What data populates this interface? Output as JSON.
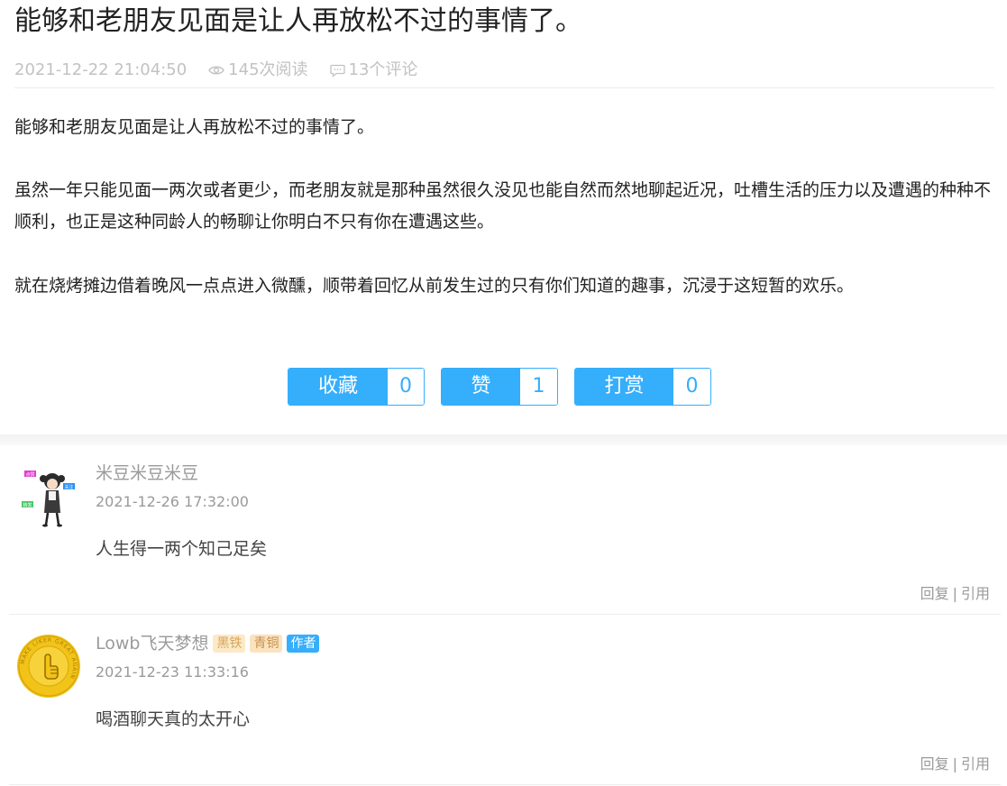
{
  "article": {
    "title": "能够和老朋友见面是让人再放松不过的事情了。",
    "date": "2021-12-22 21:04:50",
    "views": "145次阅读",
    "comments": "13个评论",
    "paragraphs": [
      "能够和老朋友见面是让人再放松不过的事情了。",
      "虽然一年只能见面一两次或者更少，而老朋友就是那种虽然很久没见也能自然而然地聊起近况，吐槽生活的压力以及遭遇的种种不顺利，也正是这种同龄人的畅聊让你明白不只有你在遭遇这些。",
      "就在烧烤摊边借着晚风一点点进入微醺，顺带着回忆从前发生过的只有你们知道的趣事，沉浸于这短暂的欢乐。"
    ]
  },
  "actions": [
    {
      "label": "收藏",
      "count": "0"
    },
    {
      "label": "赞",
      "count": "1"
    },
    {
      "label": "打赏",
      "count": "0"
    }
  ],
  "comments": [
    {
      "name": "米豆米豆米豆",
      "time": "2021-12-26 17:32:00",
      "text": "人生得一两个知己足矣",
      "badges": [],
      "avatar_tags": [
        "点赞",
        "关注",
        "转发"
      ],
      "reply": "回复",
      "quote": "引用",
      "sep": "|"
    },
    {
      "name": "Lowb飞天梦想",
      "time": "2021-12-23 11:33:16",
      "text": "喝酒聊天真的太开心",
      "badges": [
        "黑铁",
        "青铜",
        "作者"
      ],
      "avatar_ring_text": "MAKE LIKER GREAT AGAIN",
      "reply": "回复",
      "quote": "引用",
      "sep": "|"
    }
  ],
  "colors": {
    "accent": "#35aefb",
    "meta": "#c2c2c2",
    "gold": "#f2c318"
  },
  "icons": {
    "views": "eye-icon",
    "comments": "comment-bubble-icon"
  }
}
